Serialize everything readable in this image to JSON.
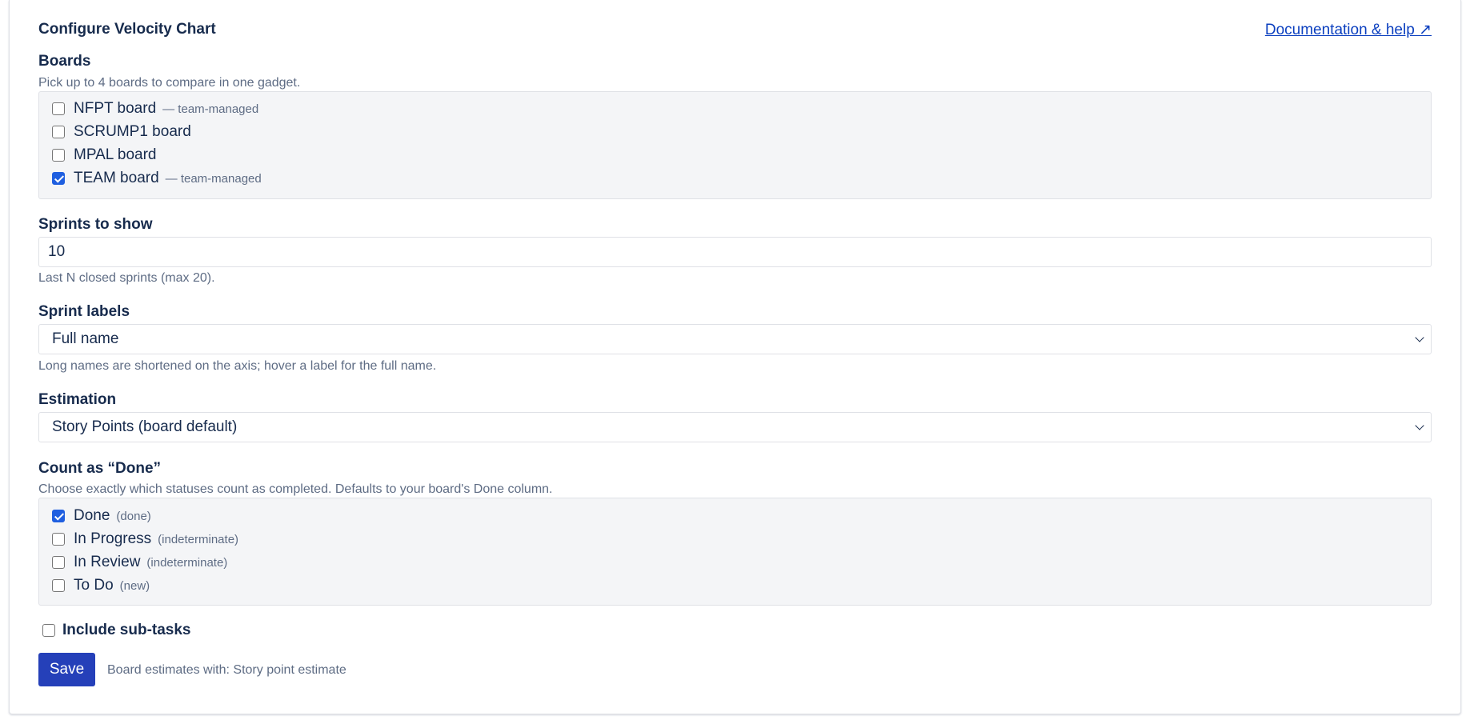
{
  "header": {
    "title": "Configure Velocity Chart",
    "doc_link": "Documentation & help ↗"
  },
  "boards": {
    "label": "Boards",
    "hint": "Pick up to 4 boards to compare in one gadget.",
    "items": [
      {
        "label": "NFPT board",
        "meta": "— team-managed",
        "checked": false
      },
      {
        "label": "SCRUMP1 board",
        "meta": "",
        "checked": false
      },
      {
        "label": "MPAL board",
        "meta": "",
        "checked": false
      },
      {
        "label": "TEAM board",
        "meta": "— team-managed",
        "checked": true
      }
    ]
  },
  "sprints": {
    "label": "Sprints to show",
    "value": "10",
    "hint": "Last N closed sprints (max 20)."
  },
  "sprint_labels": {
    "label": "Sprint labels",
    "selected": "Full name",
    "hint": "Long names are shortened on the axis; hover a label for the full name."
  },
  "estimation": {
    "label": "Estimation",
    "selected": "Story Points (board default)"
  },
  "done": {
    "label": "Count as “Done”",
    "hint": "Choose exactly which statuses count as completed. Defaults to your board's Done column.",
    "items": [
      {
        "label": "Done",
        "meta": "(done)",
        "checked": true
      },
      {
        "label": "In Progress",
        "meta": "(indeterminate)",
        "checked": false
      },
      {
        "label": "In Review",
        "meta": "(indeterminate)",
        "checked": false
      },
      {
        "label": "To Do",
        "meta": "(new)",
        "checked": false
      }
    ]
  },
  "subtasks": {
    "label": "Include sub-tasks",
    "checked": false
  },
  "footer": {
    "save_label": "Save",
    "note": "Board estimates with: Story point estimate"
  },
  "colors": {
    "accent": "#1f5fe0",
    "save_button": "#2540b9",
    "link": "#0b3fbf",
    "box_bg": "#f4f5f7"
  }
}
